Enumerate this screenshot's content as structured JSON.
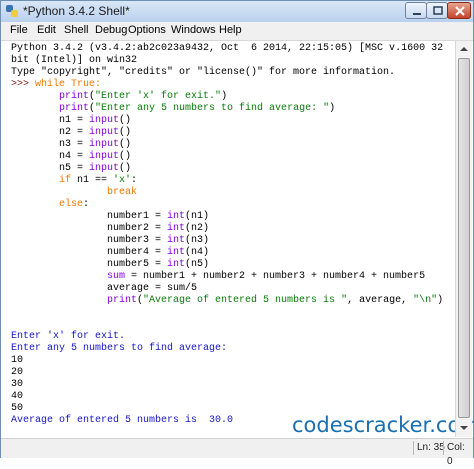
{
  "window": {
    "title": "*Python 3.4.2 Shell*",
    "icon": "python-icon"
  },
  "menubar": {
    "items": [
      "File",
      "Edit",
      "Shell",
      "Debug",
      "Options",
      "Windows",
      "Help"
    ]
  },
  "editor": {
    "banner": [
      "Python 3.4.2 (v3.4.2:ab2c023a9432, Oct  6 2014, 22:15:05) [MSC v.1600 32",
      "bit (Intel)] on win32",
      "Type \"copyright\", \"credits\" or \"license()\" for more information."
    ],
    "prompt": ">>> ",
    "code": {
      "while_kw": "while",
      "while_true": " True:",
      "l1_fn": "print",
      "l1_str": "\"Enter 'x' for exit.\"",
      "l2_fn": "print",
      "l2_str": "\"Enter any 5 numbers to find average: \"",
      "n1": "n1 = ",
      "n2": "n2 = ",
      "n3": "n3 = ",
      "n4": "n4 = ",
      "n5": "n5 = ",
      "input": "input",
      "if_kw": "if",
      "if_rest": " n1 == ",
      "if_str": "'x'",
      "break_kw": "break",
      "else_kw": "else",
      "num1": "number1 = ",
      "num2": "number2 = ",
      "num3": "number3 = ",
      "num4": "number4 = ",
      "num5": "number5 = ",
      "int": "int",
      "arg1": "(n1)",
      "arg2": "(n2)",
      "arg3": "(n3)",
      "arg4": "(n4)",
      "arg5": "(n5)",
      "sum_kw": "sum",
      "sum_rest": " = number1 + number2 + number3 + number4 + number5",
      "avg_pre": "average = ",
      "avg_sum": "sum",
      "avg_post": "/5",
      "p_fn": "print",
      "p_str1": "\"Average of entered 5 numbers is \"",
      "p_mid": ", average, ",
      "p_str2": "\"\\n\""
    },
    "output": [
      "Enter 'x' for exit.",
      "Enter any 5 numbers to find average:",
      "10",
      "20",
      "30",
      "40",
      "50",
      "Average of entered 5 numbers is  30.0"
    ]
  },
  "statusbar": {
    "line": "Ln: 35",
    "col": "Col: 0"
  },
  "watermark": "codescracker.com",
  "colors": {
    "keyword": "#f47700",
    "builtin": "#8a00d4",
    "string": "#0a7a0a",
    "output": "#1515c8"
  }
}
